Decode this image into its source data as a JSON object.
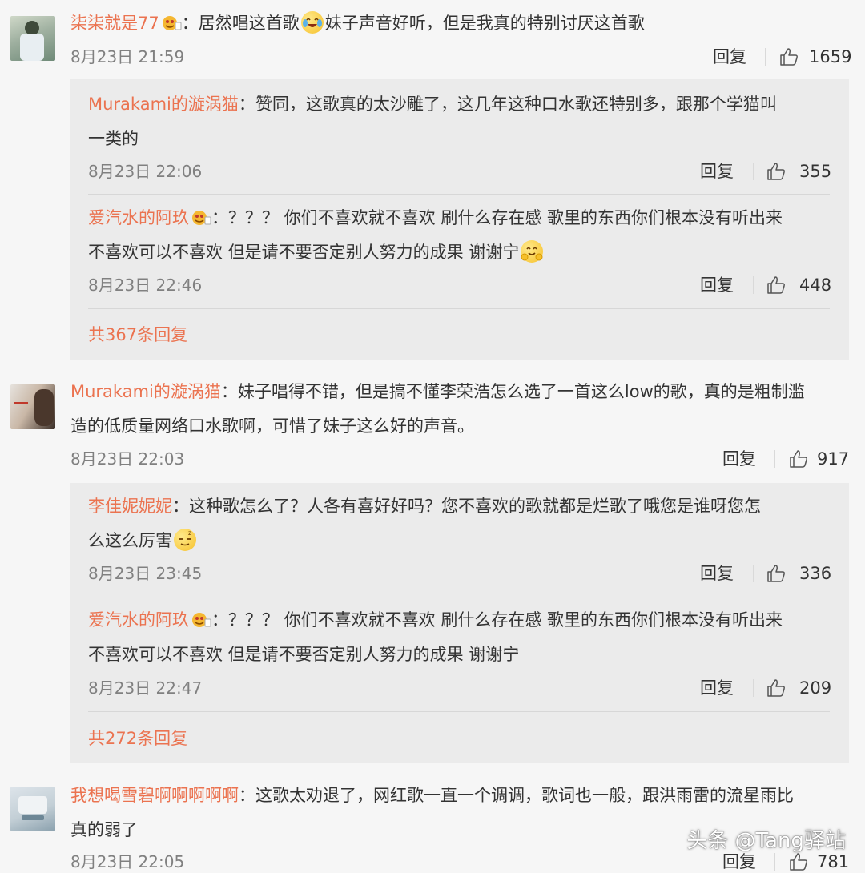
{
  "reply_label": "回复",
  "comments": [
    {
      "user": "柒柒就是77",
      "sep": "：",
      "text_a": "居然唱这首歌",
      "text_b": "妹子声音好听，但是我真的特别讨厌这首歌",
      "time": "8月23日 21:59",
      "likes": "1659",
      "avatar_icon": "user-avatar-photo",
      "badge_icon": "vip-crown-icon",
      "emoji_icon": "laughing-crying-emoji",
      "replies": [
        {
          "user": "Murakami的漩涡猫",
          "sep": "：",
          "line1": "赞同，这歌真的太沙雕了，这几年这种口水歌还特别多，跟那个学猫叫",
          "line2": "一类的",
          "time": "8月23日 22:06",
          "likes": "355"
        },
        {
          "user": "爱汽水的阿玖",
          "sep": "：",
          "line1": "？？？ 你们不喜欢就不喜欢 刷什么存在感 歌里的东西你们根本没有听出来",
          "line2": "不喜欢可以不喜欢 但是请不要否定别人努力的成果 谢谢宁",
          "time": "8月23日 22:46",
          "likes": "448",
          "emoji_icon": "hugging-face-emoji"
        }
      ],
      "more": "共367条回复"
    },
    {
      "user": "Murakami的漩涡猫",
      "sep": "：",
      "line1": "妹子唱得不错，但是搞不懂李荣浩怎么选了一首这么low的歌，真的是粗制滥",
      "line2": "造的低质量网络口水歌啊，可惜了妹子这么好的声音。",
      "time": "8月23日 22:03",
      "likes": "917",
      "avatar_icon": "user-avatar-photo",
      "replies": [
        {
          "user": "李佳妮妮妮",
          "sep": "：",
          "line1": "这种歌怎么了？人各有喜好好吗？您不喜欢的歌就都是烂歌了哦您是谁呀您怎",
          "line2": "么这么厉害",
          "time": "8月23日 23:45",
          "likes": "336",
          "emoji_icon": "sleepy-zzz-emoji"
        },
        {
          "user": "爱汽水的阿玖",
          "sep": "：",
          "line1": "？？？ 你们不喜欢就不喜欢 刷什么存在感 歌里的东西你们根本没有听出来",
          "line2": "不喜欢可以不喜欢 但是请不要否定别人努力的成果 谢谢宁",
          "time": "8月23日 22:47",
          "likes": "209"
        }
      ],
      "more": "共272条回复"
    },
    {
      "user": "我想喝雪碧啊啊啊啊啊",
      "sep": "：",
      "line1": "这歌太劝退了，网红歌一直一个调调，歌词也一般，跟洪雨雷的流星雨比",
      "line2": "真的弱了",
      "time": "8月23日 22:05",
      "likes": "781",
      "avatar_icon": "user-avatar-photo"
    }
  ],
  "watermark": "头条 @Tang驿站",
  "colors": {
    "username": "#eb7350",
    "reply_bg": "#ebebeb",
    "page_bg": "#f6f6f6"
  }
}
